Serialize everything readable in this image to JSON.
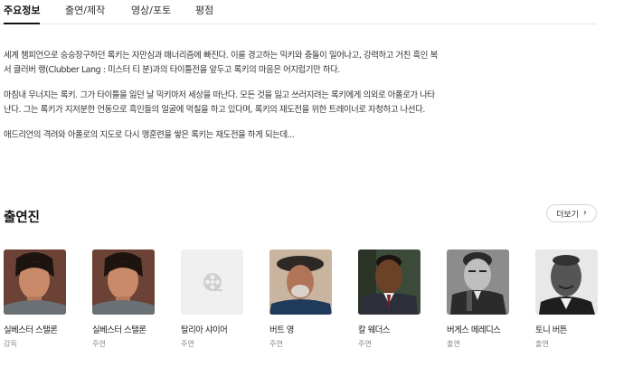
{
  "tabs": [
    {
      "label": "주요정보",
      "active": true
    },
    {
      "label": "출연/제작",
      "active": false
    },
    {
      "label": "영상/포토",
      "active": false
    },
    {
      "label": "평점",
      "active": false
    }
  ],
  "synopsis": [
    "세계 챔피언으로 승승장구하던 록키는 자만심과 매너리즘에 빠진다. 이를 경고하는 믹키와 충돌이 일어나고, 강력하고 거친 흑인 복서 클러버 랭(Clubber Lang : 미스터 티 분)과의 타이틀전을 앞두고 록키의 마음은 어지럽기만 하다.",
    "마침내 무너지는 록키. 그가 타이틀을 잃던 날 믹키마저 세상을 떠난다. 모든 것을 잃고 쓰러지려는 록키에게 의외로 아폴로가 나타난다. 그는 록키가 지저분한 언동으로 흑인들의 얼굴에 먹칠을 하고 있다며, 록키의 재도전을 위한 트레이너로 자청하고 나선다.",
    "애드리언의 격려와 아폴로의 지도로 다시 맹훈련을 쌓은 록키는 재도전을 하게 되는데..."
  ],
  "cast_section": {
    "title": "출연진",
    "more_label": "더보기",
    "more_icon": "chevron-right-icon"
  },
  "cast": [
    {
      "name": "실베스터 스탤론",
      "role": "감독",
      "photo": "portrait",
      "icon": "person-photo"
    },
    {
      "name": "실베스터 스탤론",
      "role": "주연",
      "photo": "portrait",
      "icon": "person-photo"
    },
    {
      "name": "탈리아 샤이어",
      "role": "주연",
      "photo": "placeholder",
      "icon": "film-reel-icon"
    },
    {
      "name": "버트 영",
      "role": "주연",
      "photo": "portrait",
      "icon": "person-photo"
    },
    {
      "name": "칼 웨더스",
      "role": "주연",
      "photo": "portrait",
      "icon": "person-photo"
    },
    {
      "name": "버게스 메레디스",
      "role": "출연",
      "photo": "portrait",
      "icon": "person-photo"
    },
    {
      "name": "토니 버튼",
      "role": "출연",
      "photo": "portrait",
      "icon": "person-photo"
    }
  ],
  "colors": {
    "text": "#222222",
    "muted": "#8a8a8a",
    "divider": "#e6e6e6",
    "placeholder_bg": "#f0f0f0"
  }
}
